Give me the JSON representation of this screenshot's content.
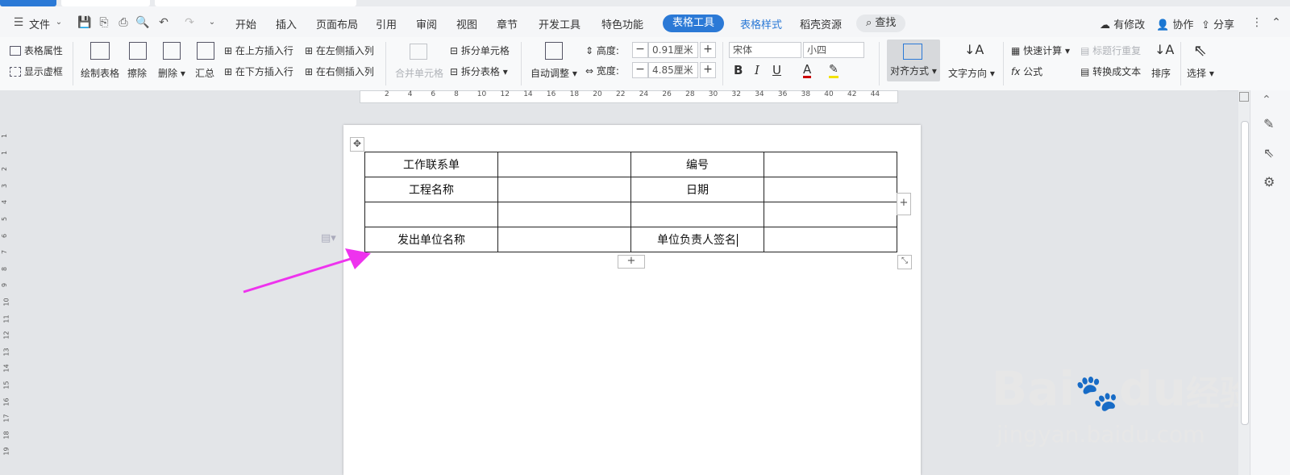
{
  "menubar": {
    "file_label": "文件",
    "tabs": [
      "开始",
      "插入",
      "页面布局",
      "引用",
      "审阅",
      "视图",
      "章节",
      "开发工具",
      "特色功能"
    ],
    "active_tab": "表格工具",
    "context_tab": "表格样式",
    "resources": "稻壳资源",
    "search": "查找",
    "has_changes": "有修改",
    "collab": "协作",
    "share": "分享"
  },
  "ribbon": {
    "table_props": "表格属性",
    "show_gridlines": "显示虚框",
    "draw_table": "绘制表格",
    "erase": "擦除",
    "delete": "删除",
    "summary": "汇总",
    "insert_above": "在上方插入行",
    "insert_below": "在下方插入行",
    "insert_left": "在左侧插入列",
    "insert_right": "在右侧插入列",
    "merge_cells": "合并单元格",
    "split_cells": "拆分单元格",
    "split_table": "拆分表格",
    "auto_fit": "自动调整",
    "height_label": "高度:",
    "height_value": "0.91厘米",
    "width_label": "宽度:",
    "width_value": "4.85厘米",
    "font_name": "宋体",
    "font_size": "小四",
    "bold": "B",
    "italic": "I",
    "underline": "U",
    "font_color": "A",
    "align": "对齐方式",
    "text_direction": "文字方向",
    "quick_calc": "快速计算",
    "formula": "公式",
    "repeat_header": "标题行重复",
    "to_text": "转换成文本",
    "sort": "排序",
    "select": "选择"
  },
  "ruler_marks": [
    "2",
    "4",
    "6",
    "8",
    "10",
    "12",
    "14",
    "16",
    "18",
    "20",
    "22",
    "24",
    "26",
    "28",
    "30",
    "32",
    "34",
    "36",
    "38",
    "40",
    "42",
    "44"
  ],
  "vruler_marks": [
    "1",
    "1",
    "2",
    "3",
    "4",
    "5",
    "6",
    "7",
    "8",
    "9",
    "10",
    "11",
    "12",
    "13",
    "14",
    "15",
    "16",
    "17",
    "18",
    "19"
  ],
  "table": {
    "rows": [
      [
        "工作联系单",
        "",
        "编号",
        ""
      ],
      [
        "工程名称",
        "",
        "日期",
        ""
      ],
      [
        "",
        "",
        "",
        ""
      ],
      [
        "发出单位名称",
        "",
        "单位负责人签名",
        ""
      ]
    ]
  },
  "watermark": {
    "brand": "Bai",
    "brand2": "du",
    "suffix": "经验",
    "url": "jingyan.baidu.com"
  },
  "colors": {
    "accent": "#2b79d6",
    "arrow": "#ee33ee"
  }
}
